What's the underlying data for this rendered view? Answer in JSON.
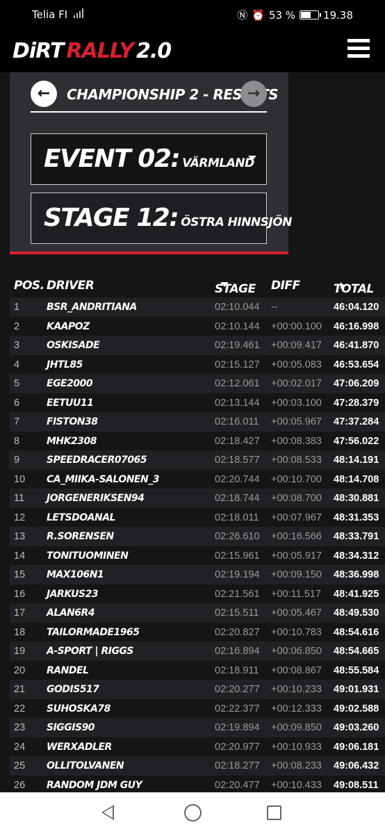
{
  "statusbar": {
    "carrier": "Telia FI",
    "network": "4G",
    "battery": "53 %",
    "battery_level": 0.53,
    "time": "19.38"
  },
  "app": {
    "logo_dirt": "DiRT",
    "logo_rally": "RALLY",
    "logo_version": "2.0"
  },
  "championship": {
    "title": "CHAMPIONSHIP 2 - RESULTS",
    "prev_icon": "arrow-left-icon",
    "next_icon": "arrow-right-icon"
  },
  "event": {
    "label": "EVENT 02:",
    "name": "VÄRMLAND"
  },
  "stage": {
    "label": "STAGE 12:",
    "name": "ÖSTRA HINNSJÖN"
  },
  "table": {
    "headers": {
      "pos": "POS.",
      "driver": "DRIVER",
      "stage": "STAGE",
      "diff": "DIFF",
      "total": "TOTAL"
    },
    "rows": [
      {
        "pos": "1",
        "driver": "BSR_ANDRITIANA",
        "stage": "02:10.044",
        "diff": "--",
        "total": "46:04.120"
      },
      {
        "pos": "2",
        "driver": "KAAPOZ",
        "stage": "02:10.144",
        "diff": "+00:00.100",
        "total": "46:16.998"
      },
      {
        "pos": "3",
        "driver": "OSKISADE",
        "stage": "02:19.461",
        "diff": "+00:09.417",
        "total": "46:41.870"
      },
      {
        "pos": "4",
        "driver": "JHTL85",
        "stage": "02:15.127",
        "diff": "+00:05.083",
        "total": "46:53.654"
      },
      {
        "pos": "5",
        "driver": "EGE2000",
        "stage": "02:12.061",
        "diff": "+00:02.017",
        "total": "47:06.209"
      },
      {
        "pos": "6",
        "driver": "EETUU11",
        "stage": "02:13.144",
        "diff": "+00:03.100",
        "total": "47:28.379"
      },
      {
        "pos": "7",
        "driver": "FISTON38",
        "stage": "02:16.011",
        "diff": "+00:05.967",
        "total": "47:37.284"
      },
      {
        "pos": "8",
        "driver": "MHK2308",
        "stage": "02:18.427",
        "diff": "+00:08.383",
        "total": "47:56.022"
      },
      {
        "pos": "9",
        "driver": "SPEEDRACER07065",
        "stage": "02:18.577",
        "diff": "+00:08.533",
        "total": "48:14.191"
      },
      {
        "pos": "10",
        "driver": "CA_MIIKA-SALONEN_3",
        "stage": "02:20.744",
        "diff": "+00:10.700",
        "total": "48:14.708"
      },
      {
        "pos": "11",
        "driver": "JORGENERIKSEN94",
        "stage": "02:18.744",
        "diff": "+00:08.700",
        "total": "48:30.881"
      },
      {
        "pos": "12",
        "driver": "LETSDOANAL",
        "stage": "02:18.011",
        "diff": "+00:07.967",
        "total": "48:31.353"
      },
      {
        "pos": "13",
        "driver": "R.SORENSEN",
        "stage": "02:26.610",
        "diff": "+00:16.566",
        "total": "48:33.791"
      },
      {
        "pos": "14",
        "driver": "TONITUOMINEN",
        "stage": "02:15.961",
        "diff": "+00:05.917",
        "total": "48:34.312"
      },
      {
        "pos": "15",
        "driver": "MAX106N1",
        "stage": "02:19.194",
        "diff": "+00:09.150",
        "total": "48:36.998"
      },
      {
        "pos": "16",
        "driver": "JARKUS23",
        "stage": "02:21.561",
        "diff": "+00:11.517",
        "total": "48:41.925"
      },
      {
        "pos": "17",
        "driver": "ALAN6R4",
        "stage": "02:15.511",
        "diff": "+00:05.467",
        "total": "48:49.530"
      },
      {
        "pos": "18",
        "driver": "TAILORMADE1965",
        "stage": "02:20.827",
        "diff": "+00:10.783",
        "total": "48:54.616"
      },
      {
        "pos": "19",
        "driver": "A-SPORT | RIGGS",
        "stage": "02:16.894",
        "diff": "+00:06.850",
        "total": "48:54.665"
      },
      {
        "pos": "20",
        "driver": "RANDEL",
        "stage": "02:18.911",
        "diff": "+00:08.867",
        "total": "48:55.584"
      },
      {
        "pos": "21",
        "driver": "GODIS517",
        "stage": "02:20.277",
        "diff": "+00:10.233",
        "total": "49:01.931"
      },
      {
        "pos": "22",
        "driver": "SUHOSKA78",
        "stage": "02:22.377",
        "diff": "+00:12.333",
        "total": "49:02.588"
      },
      {
        "pos": "23",
        "driver": "SIGGIS90",
        "stage": "02:19.894",
        "diff": "+00:09.850",
        "total": "49:03.260"
      },
      {
        "pos": "24",
        "driver": "WERXADLER",
        "stage": "02:20.977",
        "diff": "+00:10.933",
        "total": "49:06.181"
      },
      {
        "pos": "25",
        "driver": "OLLITOLVANEN",
        "stage": "02:18.277",
        "diff": "+00:08.233",
        "total": "49:06.432"
      },
      {
        "pos": "26",
        "driver": "RANDOM JDM GUY",
        "stage": "02:20.477",
        "diff": "+00:10.433",
        "total": "49:08.511"
      }
    ]
  },
  "colors": {
    "accent": "#d8202f",
    "panel": "#2d2f33",
    "background": "#151515"
  },
  "android_nav": {
    "back": "back-icon",
    "home": "home-icon",
    "recents": "recents-icon"
  }
}
